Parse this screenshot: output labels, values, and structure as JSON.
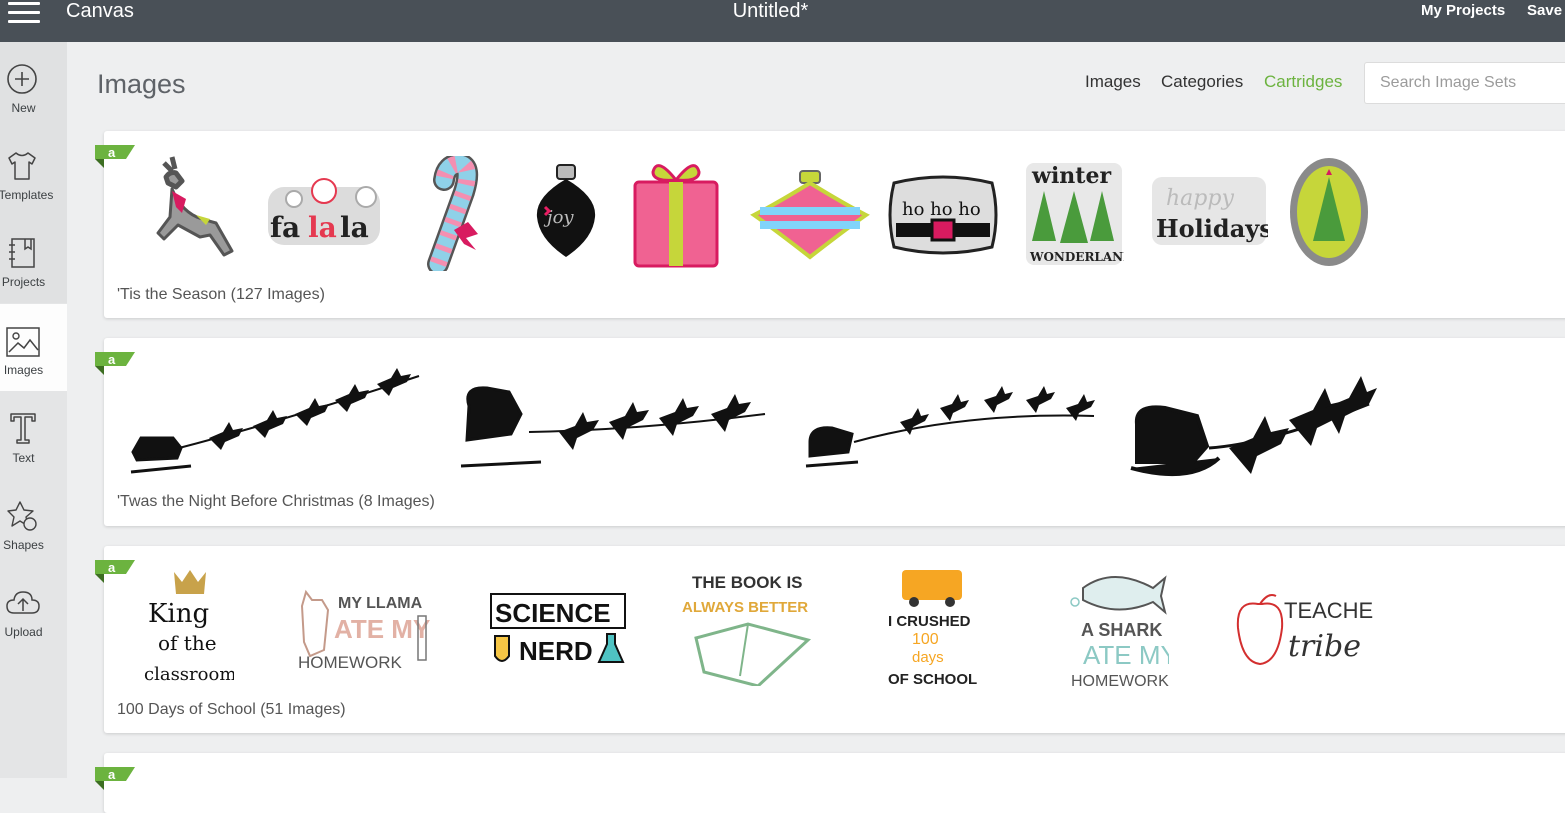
{
  "topbar": {
    "app_name": "Canvas",
    "doc_title": "Untitled*",
    "my_projects": "My Projects",
    "save": "Save"
  },
  "sidebar": {
    "items": [
      {
        "label": "New",
        "icon": "plus-circle-icon"
      },
      {
        "label": "Templates",
        "icon": "tshirt-icon"
      },
      {
        "label": "Projects",
        "icon": "notebook-icon"
      },
      {
        "label": "Images",
        "icon": "image-icon"
      },
      {
        "label": "Text",
        "icon": "text-icon"
      },
      {
        "label": "Shapes",
        "icon": "shapes-icon"
      },
      {
        "label": "Upload",
        "icon": "cloud-upload-icon"
      }
    ]
  },
  "main": {
    "title": "Images",
    "tabs": {
      "images": "Images",
      "categories": "Categories",
      "cartridges": "Cartridges"
    },
    "search_placeholder": "Search Image Sets"
  },
  "cartridges": [
    {
      "title": "'Tis the Season (127 Images)",
      "badge": "a"
    },
    {
      "title": "'Twas the Night Before Christmas (8 Images)",
      "badge": "a"
    },
    {
      "title": "100 Days of School (51 Images)",
      "badge": "a"
    },
    {
      "title": "",
      "badge": "a"
    }
  ],
  "art_text": {
    "falala": [
      "fa",
      "la",
      "la"
    ],
    "joy": "joy",
    "hohoho": "ho ho ho",
    "winter": "winter",
    "wonderland": "WONDERLAND",
    "happy": "happy",
    "holidays": "Holidays",
    "king": [
      "King",
      "of the",
      "classroom"
    ],
    "llama": [
      "MY LLAMA",
      "ATE MY",
      "HOMEWORK"
    ],
    "science": [
      "SCIENCE",
      "NERD"
    ],
    "book": [
      "THE BOOK IS",
      "ALWAYS BETTER"
    ],
    "crushed": [
      "I CRUSHED",
      "100",
      "days",
      "OF SCHOOL"
    ],
    "shark": [
      "A SHARK",
      "ATE MY",
      "HOMEWORK"
    ],
    "teacher": [
      "TEACHER",
      "tribe"
    ]
  },
  "colors": {
    "topbar": "#495057",
    "accent_green": "#6cb33f",
    "badge_green": "#6cb33f"
  }
}
